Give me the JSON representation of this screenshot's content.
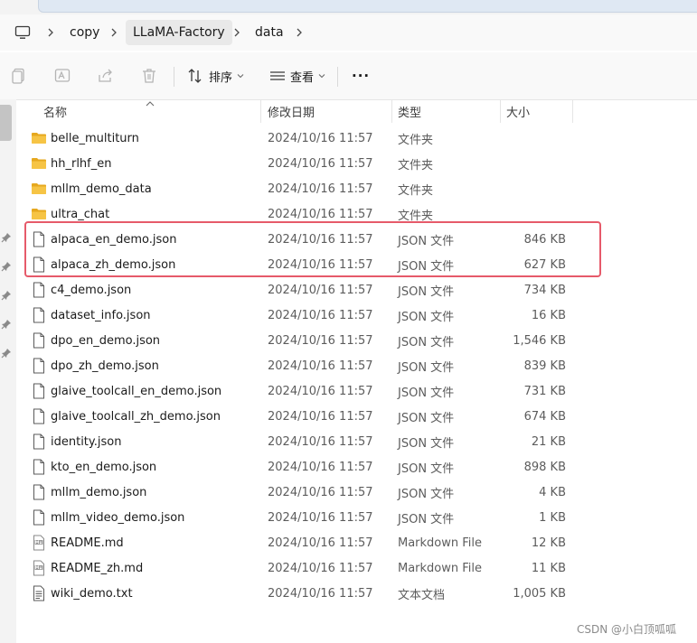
{
  "breadcrumb": {
    "items": [
      "copy",
      "LLaMA-Factory",
      "data"
    ],
    "active_index": 1
  },
  "toolbar": {
    "sort_label": "排序",
    "view_label": "查看",
    "more_label": "···"
  },
  "columns": {
    "name": "名称",
    "date": "修改日期",
    "type": "类型",
    "size": "大小"
  },
  "files": [
    {
      "name": "belle_multiturn",
      "date": "2024/10/16 11:57",
      "type": "文件夹",
      "size": "",
      "kind": "folder"
    },
    {
      "name": "hh_rlhf_en",
      "date": "2024/10/16 11:57",
      "type": "文件夹",
      "size": "",
      "kind": "folder"
    },
    {
      "name": "mllm_demo_data",
      "date": "2024/10/16 11:57",
      "type": "文件夹",
      "size": "",
      "kind": "folder"
    },
    {
      "name": "ultra_chat",
      "date": "2024/10/16 11:57",
      "type": "文件夹",
      "size": "",
      "kind": "folder"
    },
    {
      "name": "alpaca_en_demo.json",
      "date": "2024/10/16 11:57",
      "type": "JSON 文件",
      "size": "846 KB",
      "kind": "file"
    },
    {
      "name": "alpaca_zh_demo.json",
      "date": "2024/10/16 11:57",
      "type": "JSON 文件",
      "size": "627 KB",
      "kind": "file"
    },
    {
      "name": "c4_demo.json",
      "date": "2024/10/16 11:57",
      "type": "JSON 文件",
      "size": "734 KB",
      "kind": "file"
    },
    {
      "name": "dataset_info.json",
      "date": "2024/10/16 11:57",
      "type": "JSON 文件",
      "size": "16 KB",
      "kind": "file"
    },
    {
      "name": "dpo_en_demo.json",
      "date": "2024/10/16 11:57",
      "type": "JSON 文件",
      "size": "1,546 KB",
      "kind": "file"
    },
    {
      "name": "dpo_zh_demo.json",
      "date": "2024/10/16 11:57",
      "type": "JSON 文件",
      "size": "839 KB",
      "kind": "file"
    },
    {
      "name": "glaive_toolcall_en_demo.json",
      "date": "2024/10/16 11:57",
      "type": "JSON 文件",
      "size": "731 KB",
      "kind": "file"
    },
    {
      "name": "glaive_toolcall_zh_demo.json",
      "date": "2024/10/16 11:57",
      "type": "JSON 文件",
      "size": "674 KB",
      "kind": "file"
    },
    {
      "name": "identity.json",
      "date": "2024/10/16 11:57",
      "type": "JSON 文件",
      "size": "21 KB",
      "kind": "file"
    },
    {
      "name": "kto_en_demo.json",
      "date": "2024/10/16 11:57",
      "type": "JSON 文件",
      "size": "898 KB",
      "kind": "file"
    },
    {
      "name": "mllm_demo.json",
      "date": "2024/10/16 11:57",
      "type": "JSON 文件",
      "size": "4 KB",
      "kind": "file"
    },
    {
      "name": "mllm_video_demo.json",
      "date": "2024/10/16 11:57",
      "type": "JSON 文件",
      "size": "1 KB",
      "kind": "file"
    },
    {
      "name": "README.md",
      "date": "2024/10/16 11:57",
      "type": "Markdown File",
      "size": "12 KB",
      "kind": "md"
    },
    {
      "name": "README_zh.md",
      "date": "2024/10/16 11:57",
      "type": "Markdown File",
      "size": "11 KB",
      "kind": "md"
    },
    {
      "name": "wiki_demo.txt",
      "date": "2024/10/16 11:57",
      "type": "文本文档",
      "size": "1,005 KB",
      "kind": "txt"
    }
  ],
  "highlighted_files": [
    "alpaca_en_demo.json",
    "alpaca_zh_demo.json"
  ],
  "colors": {
    "highlight": "#e65a6a",
    "folder": "#f6c445",
    "folder_dark": "#e6a81f"
  },
  "watermark": "CSDN @小白顶呱呱"
}
